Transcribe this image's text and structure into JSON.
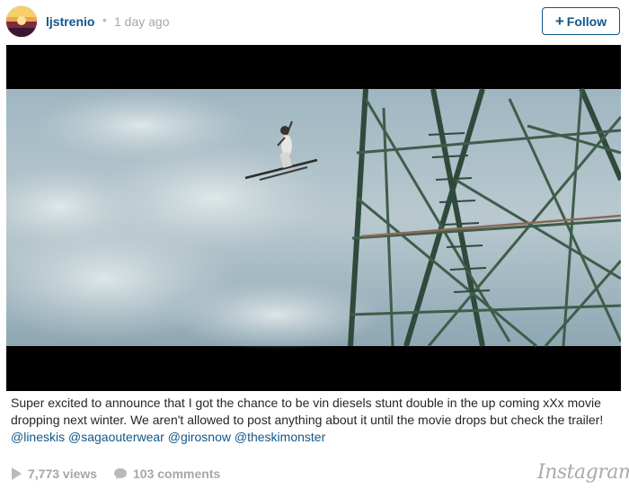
{
  "header": {
    "username": "ljstrenio",
    "separator": "•",
    "timestamp": "1 day ago",
    "follow_plus": "+",
    "follow_label": "Follow"
  },
  "caption": {
    "text": "Super excited to announce that I got the chance to be vin diesels stunt double in the up coming xXx movie dropping next winter. We aren't allowed to post anything about it until the movie drops but check the trailer!",
    "mentions": [
      "@lineskis",
      "@sagaouterwear",
      "@girosnow",
      "@theskimonster"
    ]
  },
  "footer": {
    "views": "7,773 views",
    "comments": "103 comments",
    "brand": "Instagram"
  },
  "colors": {
    "link": "#125688",
    "muted": "#a5a7aa",
    "text": "#262626"
  },
  "icons": [
    "avatar-image",
    "play-icon",
    "comment-bubble-icon"
  ]
}
